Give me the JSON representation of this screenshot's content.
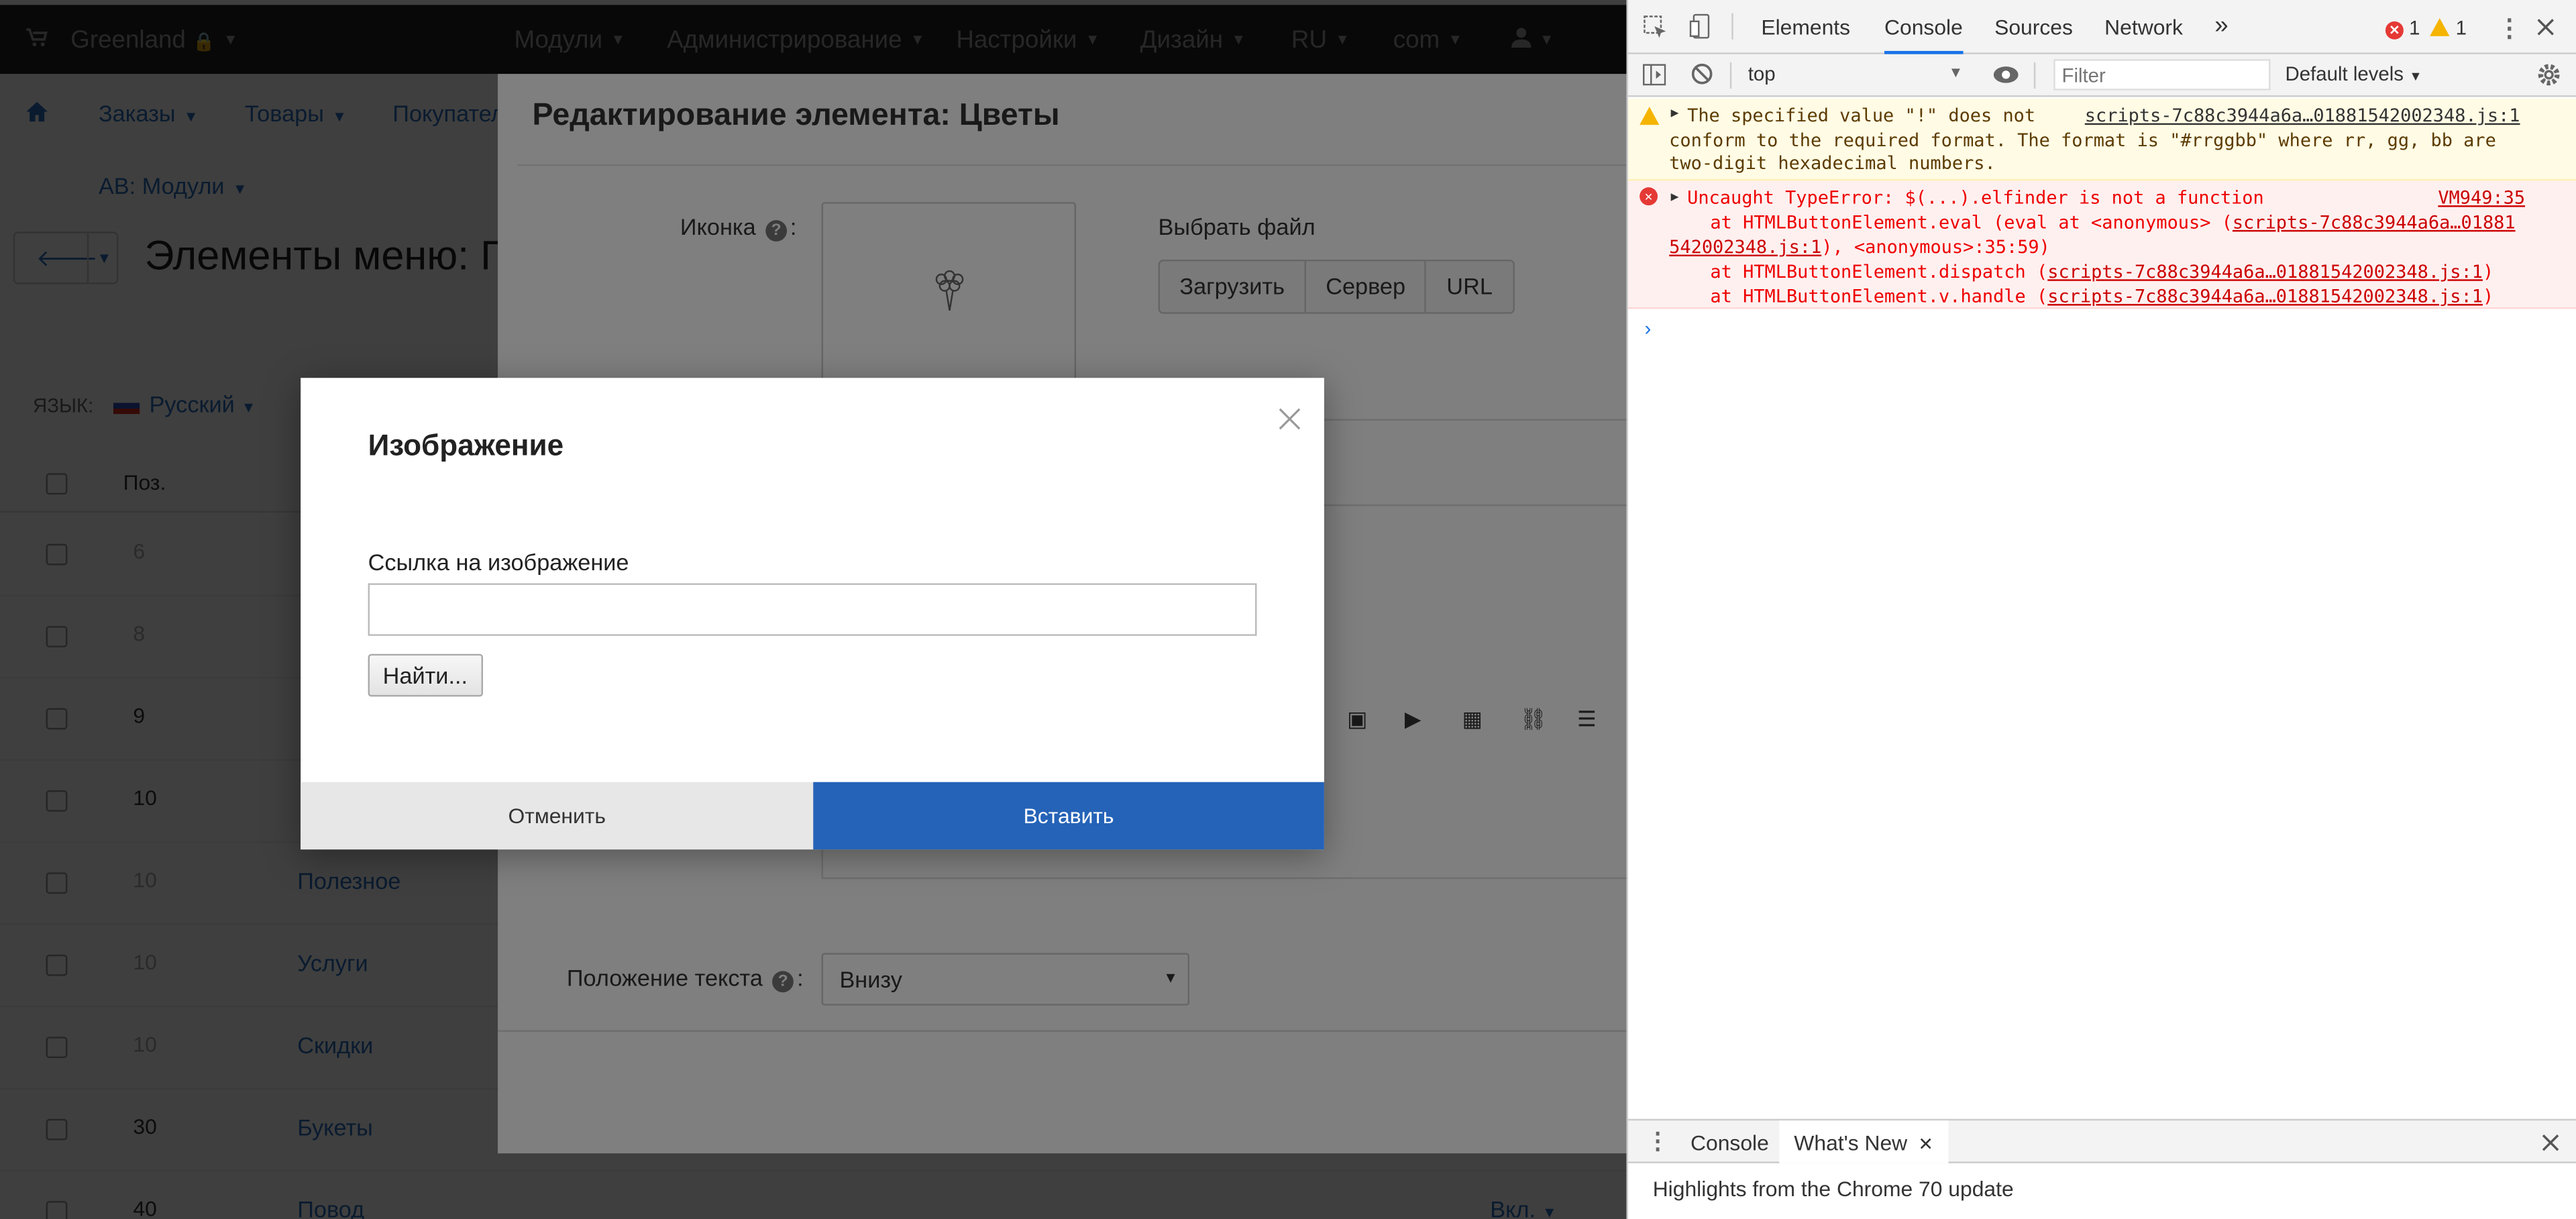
{
  "app": {
    "brand": "Greenland",
    "topnav": [
      {
        "label": "Модули"
      },
      {
        "label": "Администрирование"
      },
      {
        "label": "Настройки"
      },
      {
        "label": "Дизайн"
      },
      {
        "label": "RU"
      },
      {
        "label": "com"
      }
    ],
    "subnav": [
      {
        "label": "Заказы"
      },
      {
        "label": "Товары"
      },
      {
        "label": "Покупател"
      }
    ],
    "breadcrumb": "АВ: Модули",
    "page_title": "Элементы меню: Гл",
    "language_label": "ЯЗЫК:",
    "language_value": "Русский",
    "table_header_pos": "Поз.",
    "rows": [
      {
        "pos": "6",
        "name": ""
      },
      {
        "pos": "8",
        "name": ""
      },
      {
        "pos": "9",
        "name": ""
      },
      {
        "pos": "10",
        "name": ""
      },
      {
        "pos": "10",
        "name": "Полезное"
      },
      {
        "pos": "10",
        "name": "Услуги"
      },
      {
        "pos": "10",
        "name": "Скидки"
      },
      {
        "pos": "30",
        "name": "Букеты"
      },
      {
        "pos": "40",
        "name": "Повод"
      }
    ],
    "row_action": "Вкл."
  },
  "edit_modal": {
    "title": "Редактирование элемента: Цветы",
    "icon_label": "Иконка",
    "choose_file_label": "Выбрать файл",
    "upload_buttons": [
      "Загрузить",
      "Сервер",
      "URL"
    ],
    "text_position_label": "Положение текста",
    "text_position_value": "Внизу"
  },
  "image_dialog": {
    "title": "Изображение",
    "link_label": "Ссылка на изображение",
    "link_value": "",
    "find_button": "Найти...",
    "cancel_button": "Отменить",
    "insert_button": "Вставить"
  },
  "devtools": {
    "tabs": [
      "Elements",
      "Console",
      "Sources",
      "Network",
      "»"
    ],
    "active_tab": "Console",
    "error_count": "1",
    "warning_count": "1",
    "context": "top",
    "filter_placeholder": "Filter",
    "levels": "Default levels",
    "warning": {
      "line1": "The specified value \"!\" does not",
      "line2": "conform to the required format.  The format is \"#rrggbb\" where rr, gg, bb are",
      "line3": "two-digit hexadecimal numbers.",
      "source": "scripts-7c88c3944a6a…01881542002348.js:1"
    },
    "error": {
      "line1": "Uncaught TypeError: $(...).elfinder is not a function",
      "source": "VM949:35",
      "line2a": "at HTMLButtonElement.eval (eval at <anonymous> (",
      "line2link": "scripts-7c88c3944a6a…01881",
      "line3link": "542002348.js:1",
      "line3b": "), <anonymous>:35:59)",
      "line4a": "at HTMLButtonElement.dispatch (",
      "line4link": "scripts-7c88c3944a6a…01881542002348.js:1",
      "line5a": "at HTMLButtonElement.v.handle (",
      "line5link": "scripts-7c88c3944a6a…01881542002348.js:1",
      "close_paren": ")"
    },
    "prompt": "›",
    "drawer_tabs": [
      "Console",
      "What's New"
    ],
    "drawer_active": "What's New",
    "whats_new_text": "Highlights from the Chrome 70 update"
  }
}
